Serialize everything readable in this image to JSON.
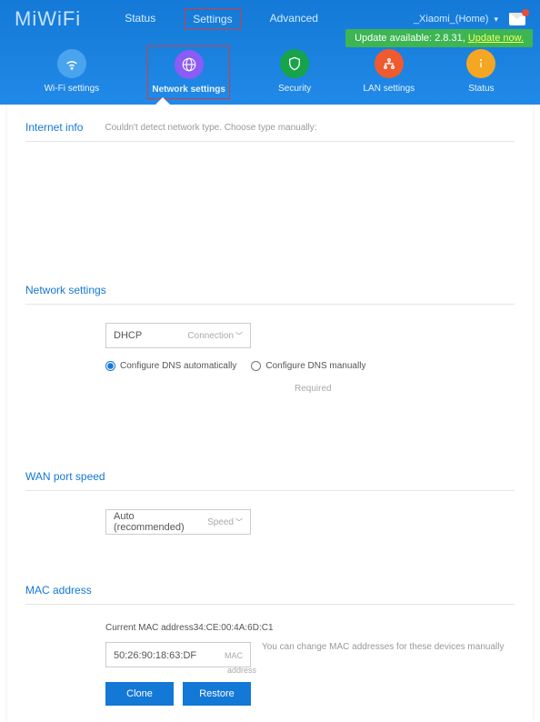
{
  "logo": "MiWiFi",
  "topnav": {
    "status": "Status",
    "settings": "Settings",
    "advanced": "Advanced"
  },
  "account": {
    "name": "_Xiaomi_(Home)"
  },
  "update": {
    "text": "Update available: 2.8.31,",
    "link": "Update now."
  },
  "subnav": {
    "wifi": "Wi-Fi settings",
    "network": "Network settings",
    "security": "Security",
    "lan": "LAN settings",
    "status": "Status"
  },
  "internet_info": {
    "title": "Internet info",
    "note": "Couldn't detect network type. Choose type manually:"
  },
  "network_settings": {
    "title": "Network settings",
    "connection_value": "DHCP",
    "connection_label": "Connection",
    "dns_auto": "Configure DNS automatically",
    "dns_manual": "Configure DNS manually",
    "required": "Required"
  },
  "wan": {
    "title": "WAN port speed",
    "value": "Auto (recommended)",
    "label": "Speed"
  },
  "mac": {
    "title": "MAC address",
    "current_prefix": "Current MAC address",
    "current_value": "34:CE:00:4A:6D:C1",
    "input_value": "50:26:90:18:63:DF",
    "input_label": "MAC address",
    "note": "You can change MAC addresses for these devices manually",
    "clone": "Clone",
    "restore": "Restore"
  }
}
